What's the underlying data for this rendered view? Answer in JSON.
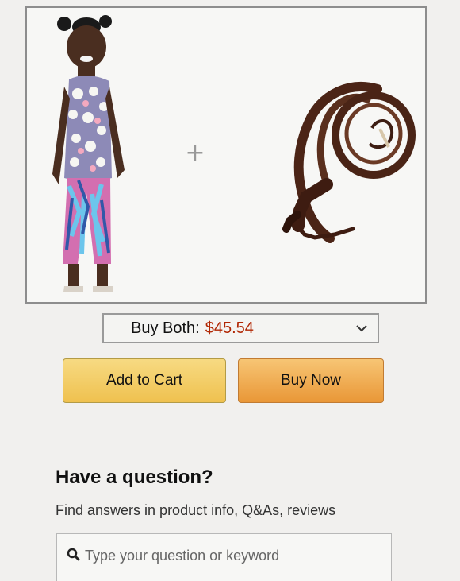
{
  "bundle": {
    "items": [
      {
        "name": "child-outfit"
      },
      {
        "name": "leather-whip"
      }
    ],
    "plus_symbol": "+",
    "buy_both_label": "Buy Both:",
    "buy_both_price": "$45.54"
  },
  "actions": {
    "add_to_cart_label": "Add to Cart",
    "buy_now_label": "Buy Now"
  },
  "questions": {
    "title": "Have a question?",
    "subtitle": "Find answers in product info, Q&As, reviews",
    "search_placeholder": "Type your question or keyword"
  },
  "colors": {
    "price": "#b12704",
    "add_to_cart": "#f0c14b",
    "buy_now": "#f0a94a",
    "background": "#f1f0ee"
  }
}
